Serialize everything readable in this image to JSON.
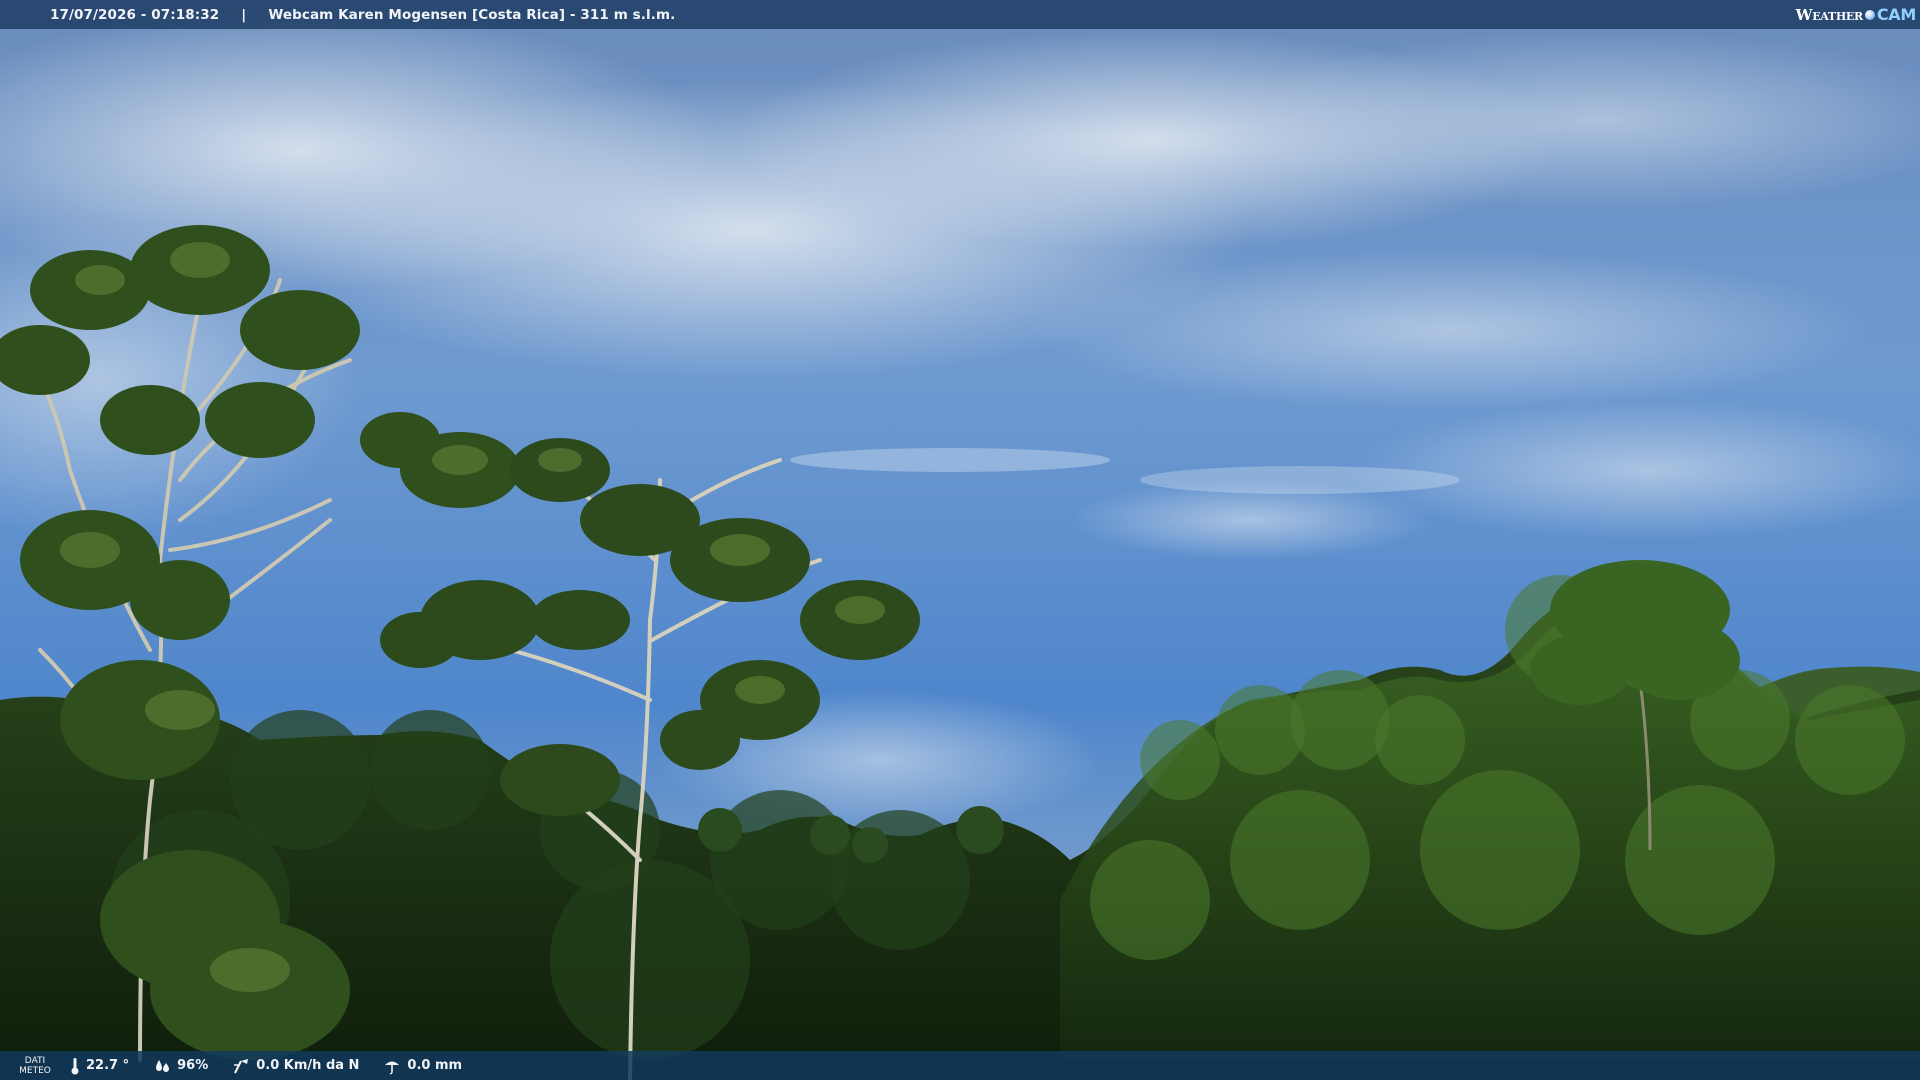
{
  "header": {
    "datetime": "17/07/2026 - 07:18:32",
    "separator": "|",
    "location": "Webcam Karen Mogensen [Costa Rica] - 311 m s.l.m.",
    "brand_weather": "Weather",
    "brand_cam": "CAM"
  },
  "footer": {
    "label_line1": "DATI",
    "label_line2": "METEO",
    "temperature": "22.7 °",
    "humidity": "96%",
    "wind": "0.0 Km/h da N",
    "rain": "0.0 mm",
    "icons": [
      "thermometer-icon",
      "humidity-icon",
      "wind-icon",
      "rain-icon"
    ]
  },
  "colors": {
    "sky_top": "#5a82b8",
    "sky_bottom": "#3f78c4",
    "foliage_dark": "#14250f",
    "foliage_light": "#3d6a22",
    "bar": "#1c3a62"
  }
}
